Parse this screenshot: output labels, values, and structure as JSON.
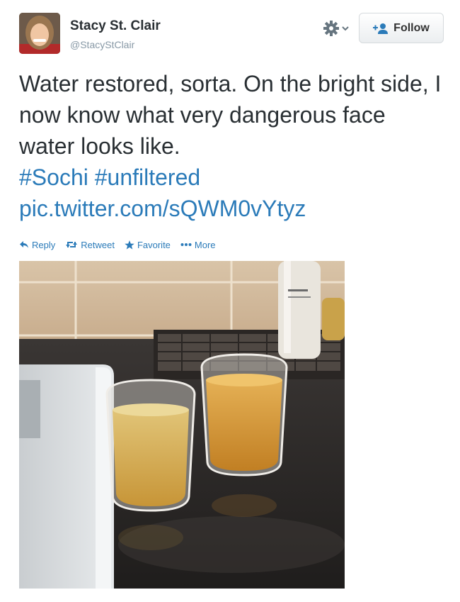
{
  "user": {
    "name": "Stacy St. Clair",
    "handle": "@StacyStClair"
  },
  "follow": {
    "label": "Follow"
  },
  "tweet": {
    "text": "Water restored, sorta. On the bright side, I now know what very dangerous face water looks like.",
    "hashtag1": "#Sochi",
    "hashtag2": "#unfiltered",
    "link": "pic.twitter.com/sQWM0vYtyz"
  },
  "actions": {
    "reply": "Reply",
    "retweet": "Retweet",
    "favorite": "Favorite",
    "more": "More"
  },
  "colors": {
    "link": "#2b7bb9",
    "text": "#292f33",
    "muted": "#8899a6"
  },
  "icons": [
    "gear-icon",
    "chevron-down-icon",
    "add-user-icon",
    "reply-icon",
    "retweet-icon",
    "star-icon",
    "more-icon"
  ]
}
